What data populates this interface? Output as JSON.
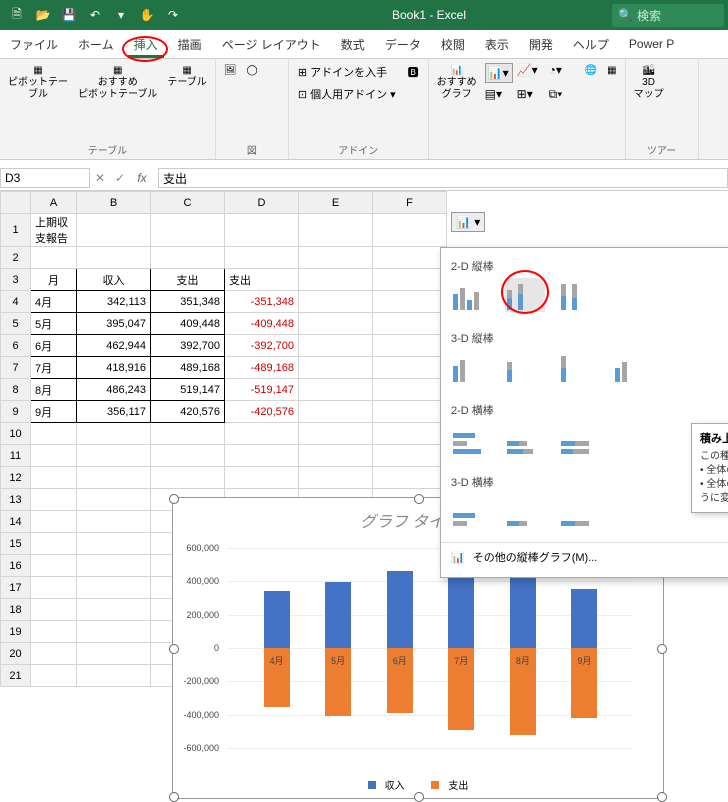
{
  "titlebar": {
    "title": "Book1 - Excel",
    "search_placeholder": "検索"
  },
  "tabs": [
    "ファイル",
    "ホーム",
    "挿入",
    "描画",
    "ページ レイアウト",
    "数式",
    "データ",
    "校閲",
    "表示",
    "開発",
    "ヘルプ",
    "Power P"
  ],
  "active_tab": "挿入",
  "ribbon_groups": {
    "tables": {
      "pivot": "ピボットテー\nブル",
      "recommended_pivot": "おすすめ\nピボットテーブル",
      "table": "テーブル",
      "label": "テーブル"
    },
    "illustrations": {
      "label": "図"
    },
    "addins": {
      "get": "アドインを入手",
      "personal": "個人用アドイン",
      "label": "アドイン"
    },
    "charts": {
      "recommended": "おすすめ\nグラフ"
    },
    "tours": {
      "map3d": "3D\nマップ",
      "label": "ツアー"
    }
  },
  "namebox": {
    "ref": "D3",
    "formula": "支出"
  },
  "sheet": {
    "title_text": "上期収支報告",
    "cols": [
      "A",
      "B",
      "C",
      "D",
      "E",
      "F"
    ],
    "header_row": {
      "month": "月",
      "income": "収入",
      "expense": "支出",
      "expense2": "支出"
    },
    "rows": [
      {
        "m": "4月",
        "inc": "342,113",
        "exp": "351,348",
        "neg": "-351,348"
      },
      {
        "m": "5月",
        "inc": "395,047",
        "exp": "409,448",
        "neg": "-409,448"
      },
      {
        "m": "6月",
        "inc": "462,944",
        "exp": "392,700",
        "neg": "-392,700"
      },
      {
        "m": "7月",
        "inc": "418,916",
        "exp": "489,168",
        "neg": "-489,168"
      },
      {
        "m": "8月",
        "inc": "486,243",
        "exp": "519,147",
        "neg": "-519,147"
      },
      {
        "m": "9月",
        "inc": "356,117",
        "exp": "420,576",
        "neg": "-420,576"
      }
    ]
  },
  "chart_popup": {
    "sec_2d_col": "2-D 縦棒",
    "sec_3d_col": "3-D 縦棒",
    "sec_2d_bar": "2-D 横棒",
    "sec_3d_bar": "3-D 横棒",
    "more": "その他の縦棒グラフ(M)...",
    "tooltip": {
      "title": "積み上げ縦棒",
      "line1": "この種類のグラフの使用目的:",
      "line2": "• 全体の中の各部分を比較します。",
      "line3": "• 全体の中の各部分が時間とともにどのように変化するかを示します。"
    }
  },
  "chart_data": {
    "type": "bar",
    "title": "グラフ タイトル",
    "categories": [
      "4月",
      "5月",
      "6月",
      "7月",
      "8月",
      "9月"
    ],
    "series": [
      {
        "name": "収入",
        "values": [
          342113,
          395047,
          462944,
          418916,
          486243,
          356117
        ],
        "color": "#4472c4"
      },
      {
        "name": "支出",
        "values": [
          -351348,
          -409448,
          -392700,
          -489168,
          -519147,
          -420576
        ],
        "color": "#ed7d31"
      }
    ],
    "ylim": [
      -600000,
      600000
    ],
    "ylabels": [
      "600,000",
      "400,000",
      "200,000",
      "0",
      "-200,000",
      "-400,000",
      "-600,000"
    ]
  }
}
